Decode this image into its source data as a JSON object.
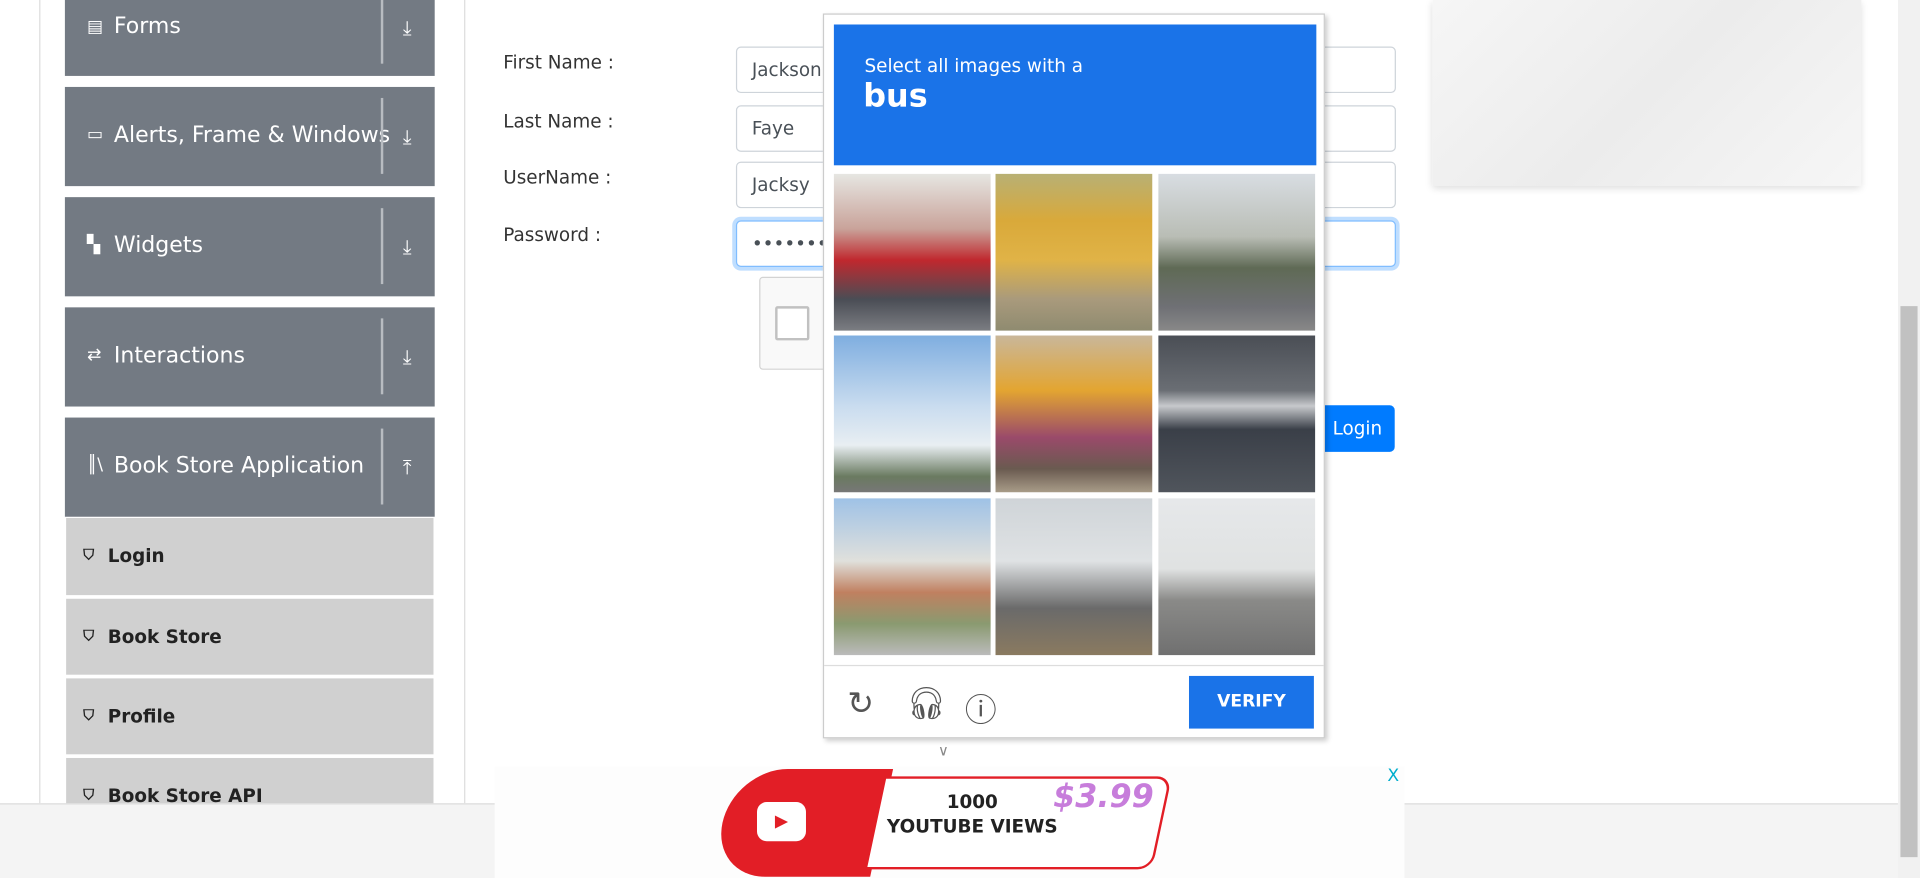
{
  "sidebar": {
    "groups": [
      {
        "label": "Forms",
        "icon": "document-icon",
        "expanded": false
      },
      {
        "label": "Alerts, Frame & Windows",
        "icon": "window-icon",
        "expanded": false
      },
      {
        "label": "Widgets",
        "icon": "widgets-icon",
        "expanded": false
      },
      {
        "label": "Interactions",
        "icon": "interactions-icon",
        "expanded": false
      },
      {
        "label": "Book Store Application",
        "icon": "books-icon",
        "expanded": true
      }
    ],
    "book_store_items": [
      {
        "label": "Login"
      },
      {
        "label": "Book Store"
      },
      {
        "label": "Profile"
      },
      {
        "label": "Book Store API"
      }
    ]
  },
  "form": {
    "first_name_label": "First Name :",
    "first_name_value": "Jackson",
    "last_name_label": "Last Name :",
    "last_name_value": "Faye",
    "username_label": "UserName :",
    "username_value": "Jacksy",
    "password_label": "Password :",
    "password_value": "••••••••••",
    "login_label": "Login"
  },
  "captcha": {
    "instruction": "Select all images with a",
    "target": "bus",
    "verify_label": "VERIFY",
    "header_color": "#1a73e8"
  },
  "ad": {
    "line1": "1000",
    "line2": "YOUTUBE VIEWS",
    "price": "$3.99",
    "close": "X"
  }
}
